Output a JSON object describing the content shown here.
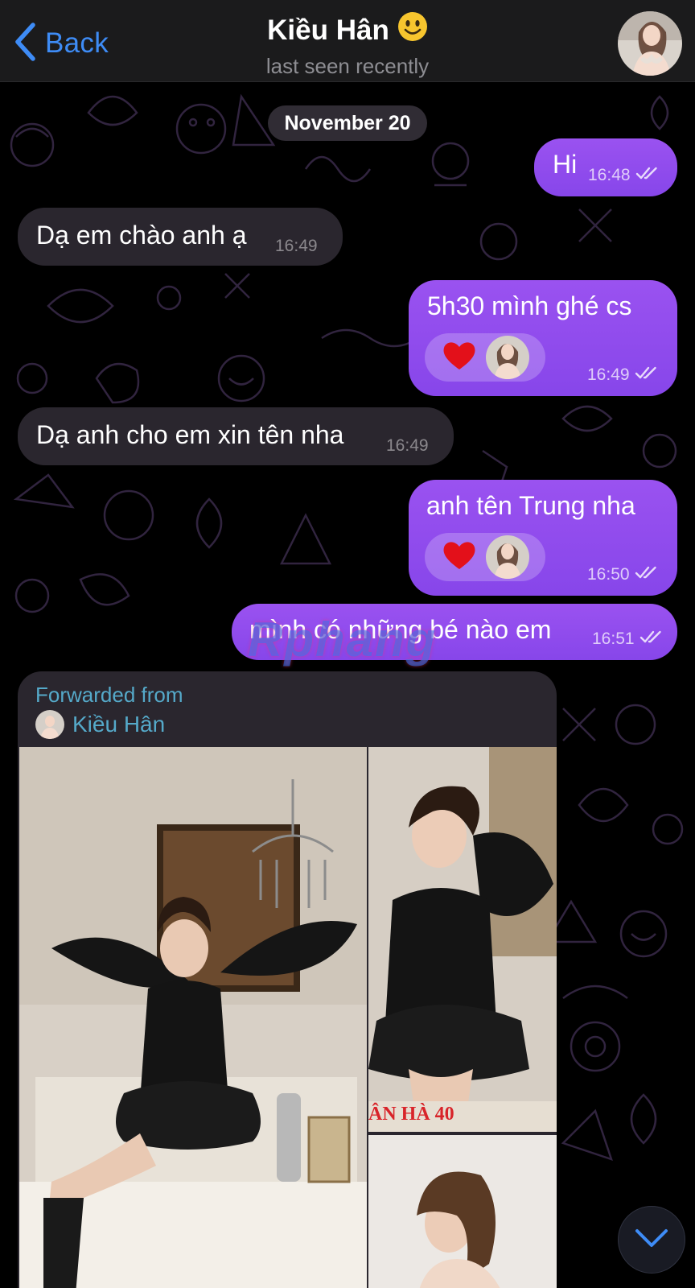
{
  "header": {
    "back_label": "Back",
    "contact_name": "Kiều Hân",
    "status": "last seen recently"
  },
  "date_separator": "November 20",
  "messages": [
    {
      "direction": "out",
      "text": "Hi",
      "time": "16:48",
      "read": true
    },
    {
      "direction": "in",
      "text": "Dạ em chào anh ạ",
      "time": "16:49"
    },
    {
      "direction": "out",
      "text": "5h30 mình ghé cs",
      "time": "16:49",
      "read": true,
      "reaction": "heart"
    },
    {
      "direction": "in",
      "text": "Dạ anh cho em xin tên nha",
      "time": "16:49"
    },
    {
      "direction": "out",
      "text": "anh tên Trung nha",
      "time": "16:50",
      "read": true,
      "reaction": "heart"
    },
    {
      "direction": "out",
      "text": "mình có những bé nào em",
      "time": "16:51",
      "read": true
    }
  ],
  "forwarded": {
    "label": "Forwarded from",
    "source_name": "Kiều Hân",
    "photo_caption": "ÂN HÀ 40"
  },
  "watermark": "Rphang",
  "colors": {
    "outgoing_bubble": "#8f4cee",
    "incoming_bubble": "#2a262e",
    "accent_link": "#3e8cf6",
    "forward_text": "#55a9c9",
    "header_bg": "#1b1b1c"
  }
}
